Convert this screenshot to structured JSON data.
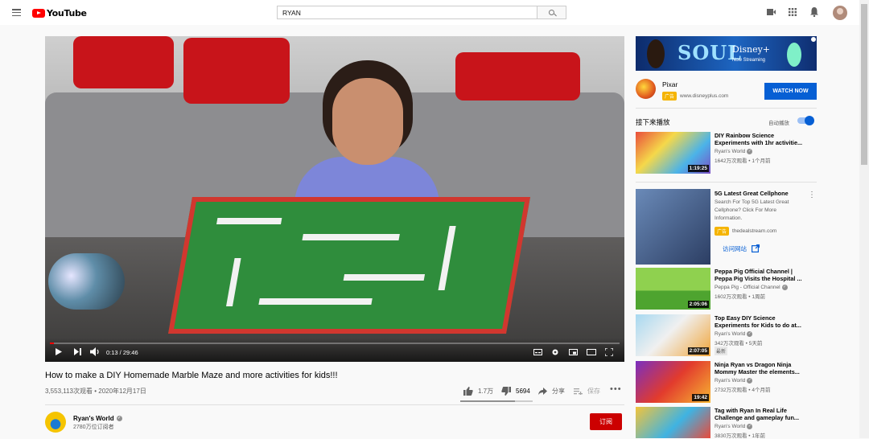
{
  "header": {
    "logo_text": "YouTube",
    "search_value": "RYAN"
  },
  "player": {
    "time": "0:13 / 29:46",
    "progress_fraction": 0.007
  },
  "video": {
    "title": "How to make a DIY Homemade Marble Maze and more activities for kids!!!",
    "meta": "3,553,113次观看 • 2020年12月17日",
    "likes": "1.7万",
    "dislikes": "5694",
    "share_label": "分享",
    "save_label": "保存",
    "like_fraction": 0.75
  },
  "channel": {
    "name": "Ryan's World",
    "subscribers": "2780万位订阅者",
    "subscribe_label": "订阅"
  },
  "ad": {
    "soul_text": "SOUL",
    "brand_text": "Disney+",
    "tagline": "Now Streaming",
    "advertiser": "Pixar",
    "badge": "广告",
    "url": "www.disneyplus.com",
    "cta": "WATCH NOW"
  },
  "sidebar": {
    "up_next": "接下来播放",
    "autoplay": "自动播放",
    "ad_card": {
      "title": "5G Latest Great Cellphone",
      "description": "Search For Top 5G Latest Great Cellphone? Click For More Information.",
      "badge": "广告",
      "url": "thedealstream.com",
      "visit": "访问网站"
    },
    "recommendations": [
      {
        "title": "DIY Rainbow Science Experiments with 1hr activitie...",
        "channel": "Ryan's World",
        "meta": "1642万次观看 • 1个月前",
        "duration": "1:19:25",
        "badge": ""
      },
      {
        "title": "Peppa Pig Official Channel | Peppa Pig Visits the Hospital ...",
        "channel": "Peppa Pig - Official Channel",
        "meta": "1602万次观看 • 1周前",
        "duration": "2:05:06",
        "badge": ""
      },
      {
        "title": "Top Easy DIY Science Experiments for Kids to do at...",
        "channel": "Ryan's World",
        "meta": "342万次观看 • 5天前",
        "duration": "2:07:05",
        "badge": "最新"
      },
      {
        "title": "Ninja Ryan vs Dragon Ninja Mommy Master the elements...",
        "channel": "Ryan's World",
        "meta": "2732万次观看 • 4个月前",
        "duration": "19:42",
        "badge": ""
      },
      {
        "title": "Tag with Ryan In Real Life Challenge and gameplay fun...",
        "channel": "Ryan's World",
        "meta": "3830万次观看 • 1年前",
        "duration": "",
        "badge": ""
      }
    ]
  }
}
